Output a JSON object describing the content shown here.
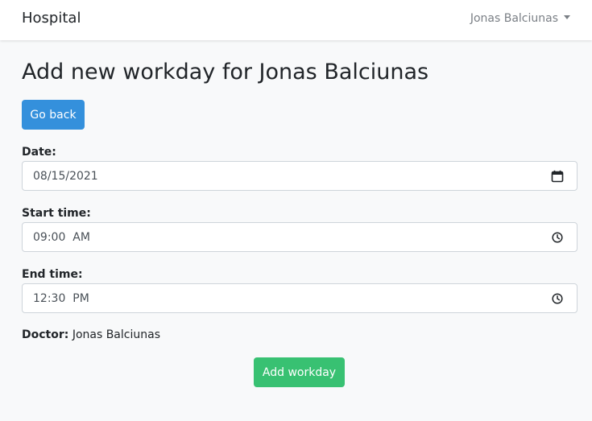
{
  "navbar": {
    "brand": "Hospital",
    "user_name": "Jonas Balciunas"
  },
  "page": {
    "title": "Add new workday for Jonas Balciunas",
    "back_button": "Go back"
  },
  "form": {
    "date": {
      "label": "Date:",
      "value": "08/15/2021",
      "icon": "calendar-icon"
    },
    "start_time": {
      "label": "Start time:",
      "value": "09:00  AM",
      "icon": "clock-icon"
    },
    "end_time": {
      "label": "End time:",
      "value": "12:30  PM",
      "icon": "clock-icon"
    },
    "doctor": {
      "label": "Doctor:",
      "value": "Jonas Balciunas"
    },
    "submit_button": "Add workday"
  },
  "colors": {
    "primary": "#3490dc",
    "success": "#38c172",
    "background": "#f8f9fa"
  }
}
